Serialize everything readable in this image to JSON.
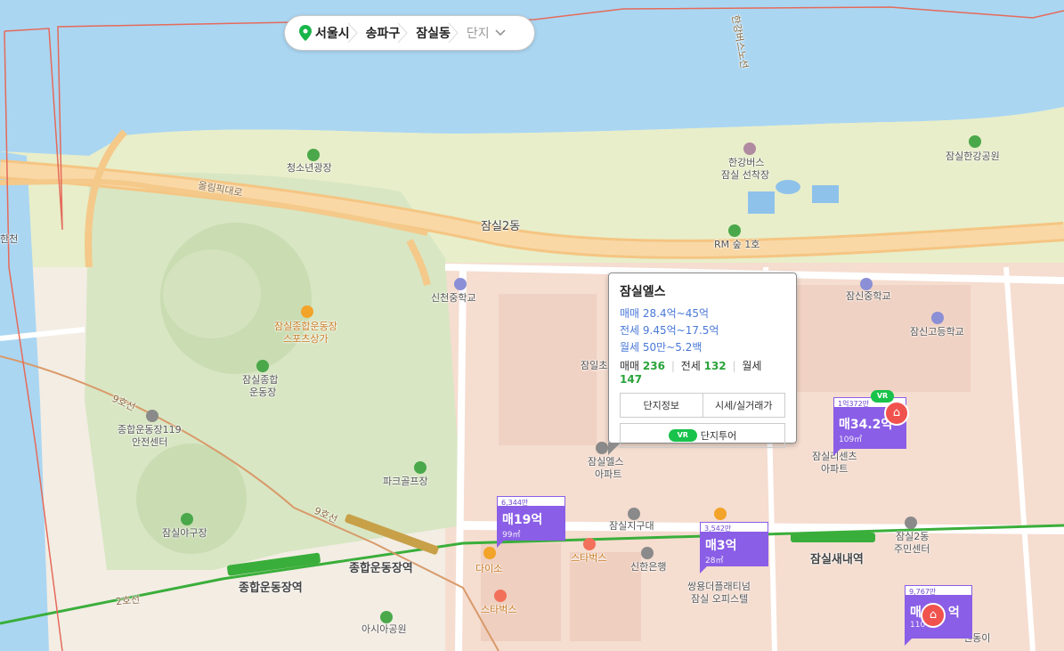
{
  "breadcrumb": {
    "items": [
      "서울시",
      "송파구",
      "잠실동"
    ],
    "last": "단지",
    "pin_color": "#19b54a"
  },
  "map_labels": {
    "youth_plaza": "청소년광장",
    "olympic_road": "올림픽대로",
    "jamsil2dong": "잠실2동",
    "hangang_bus": "한강버스",
    "hangang_bus2": "잠실 선착장",
    "rm": "RM 숲 1호",
    "jamsil_hangang_park": "잠실한강공원",
    "sincheon_middle": "신천중학교",
    "jamsil_middle": "잠신중학교",
    "jamsin_high": "잠신고등학교",
    "sports_mall": "잠실종합운동장",
    "sports_mall2": "스포츠상가",
    "sports_complex": "잠실종합",
    "sports_complex2": "운동장",
    "safety_center": "종합운동장119",
    "safety_center2": "안전센터",
    "park_golf": "파크골프장",
    "baseball": "잠실야구장",
    "jamsil_elementary": "잠일초",
    "elsa_apt": "잠실엘스",
    "elsa_apt2": "아파트",
    "lecents_apt": "잠실리센츠",
    "lecents_apt2": "아파트",
    "jamsil_market": "잠실지구대",
    "jamsil2dong_center": "잠실2동",
    "jamsil2dong_center2": "주민센터",
    "daiso": "다이소",
    "starbucks1": "스타벅스",
    "starbucks2": "스타벅스",
    "shinhan": "신한은행",
    "ssangyong": "쌍용더플래티넘",
    "ssangyong2": "잠실 오피스텔",
    "asian_park": "아시아공원",
    "sports_station": "종합운동장역",
    "sports_station2": "종합운동장역",
    "jamsilsaenae": "잠실새내역",
    "line2": "2호선",
    "line9": "9호선",
    "line9b": "9호선",
    "han_left": "한천",
    "yeongdong": "엔동이",
    "riverside_road": "한강버스노선"
  },
  "popup": {
    "title": "잠실엘스",
    "sale_range": "매매 28.4억~45억",
    "jeonse_range": "전세 9.45억~17.5억",
    "monthly_range": "월세 50만~5.2백",
    "sale_label": "매매",
    "sale_count": "236",
    "jeonse_label": "전세",
    "jeonse_count": "132",
    "monthly_label": "월세",
    "monthly_count": "147",
    "btn_info": "단지정보",
    "btn_price": "시세/실거래가",
    "btn_tour": "단지투어",
    "vr": "VR"
  },
  "markers": [
    {
      "top": "6,344만",
      "price": "매19억",
      "area": "99㎡"
    },
    {
      "top": "3,542만",
      "price": "매3억",
      "area": "28㎡"
    },
    {
      "top": "1억372만",
      "price": "매34.2억",
      "area": "109㎡"
    },
    {
      "top": "9,767만",
      "price": "매",
      "price2": "억",
      "area": "110"
    }
  ],
  "colors": {
    "water": "#a8d4f0",
    "park": "#d6e6bf",
    "road": "#f4c98a",
    "marker": "#8a5ee6",
    "line2": "#3aae3a",
    "line9": "#c7a048"
  }
}
